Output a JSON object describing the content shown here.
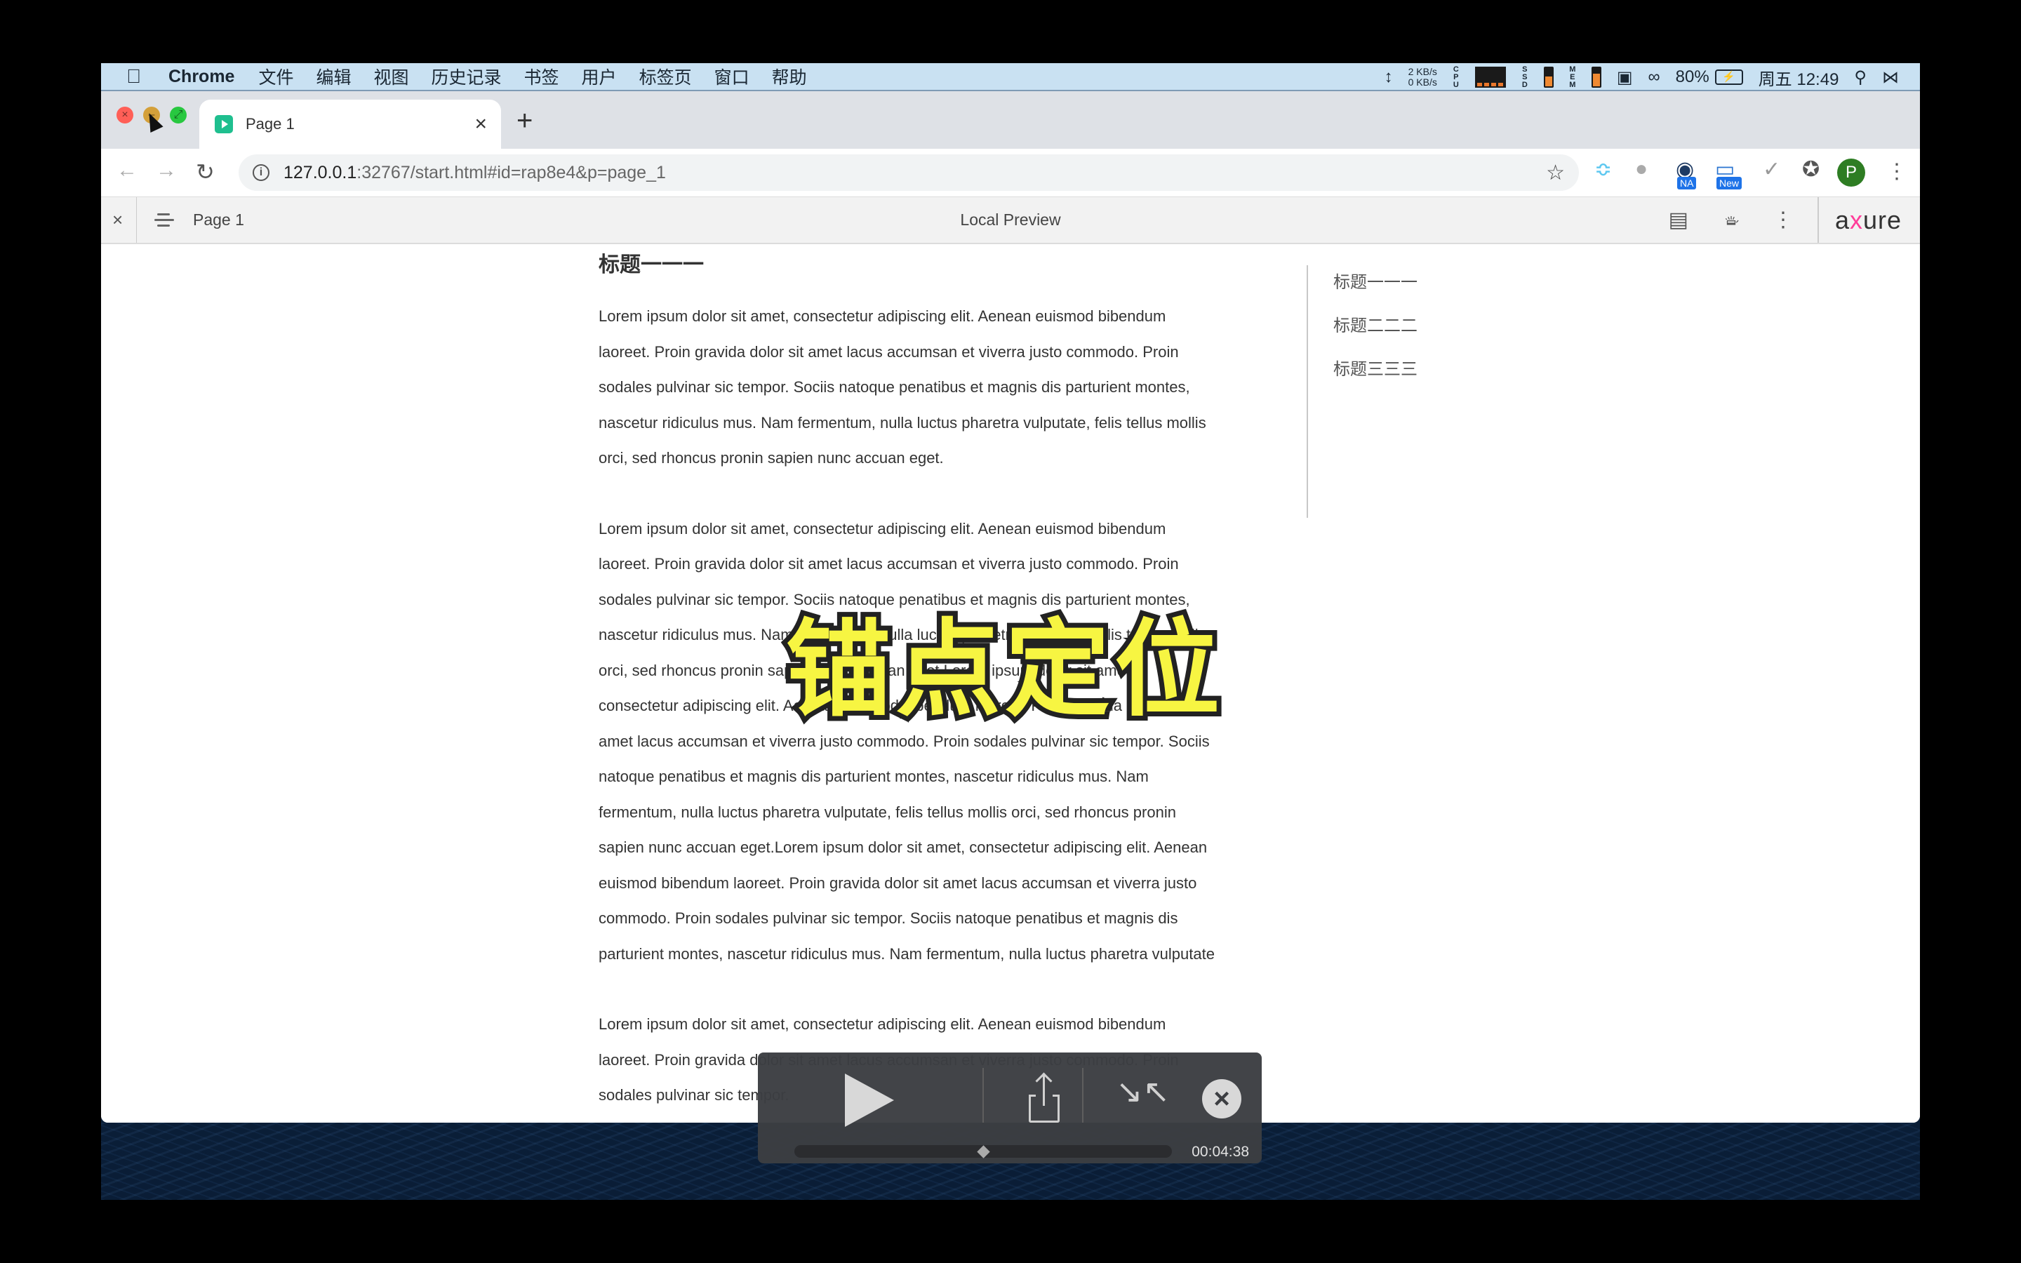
{
  "menubar": {
    "apple_icon": "apple-logo-icon",
    "app_name": "Chrome",
    "items": [
      "文件",
      "编辑",
      "视图",
      "历史记录",
      "书签",
      "用户",
      "标签页",
      "窗口",
      "帮助"
    ],
    "status": {
      "net_up": "2 KB/s",
      "net_down": "0 KB/s",
      "cpu_label": "CPU",
      "ssd_label": "SSD",
      "mem_label": "MEM",
      "ssd_fill": 0.55,
      "mem_fill": 0.7,
      "battery_percent": "80%",
      "datetime": "周五 12:49"
    }
  },
  "browser": {
    "tab": {
      "title": "Page 1",
      "close": "×"
    },
    "new_tab": "+",
    "url_host": "127.0.0.1",
    "url_rest": ":32767/start.html#id=rap8e4&p=page_1",
    "extensions": [
      {
        "name": "ext-waves-icon"
      },
      {
        "name": "ext-gray-swirl-icon"
      },
      {
        "name": "ext-na-icon",
        "badge": "NA"
      },
      {
        "name": "ext-new-icon",
        "badge": "New"
      },
      {
        "name": "ext-check-icon"
      },
      {
        "name": "extensions-puzzle-icon"
      }
    ],
    "profile_initial": "P"
  },
  "axure_bar": {
    "page_name": "Page 1",
    "center_label": "Local Preview",
    "logo": {
      "pre": "a",
      "x": "x",
      "post": "ure"
    }
  },
  "content": {
    "heading": "标题一一一",
    "paragraphs": [
      "Lorem ipsum dolor sit amet, consectetur adipiscing elit. Aenean euismod bibendum laoreet. Proin gravida dolor sit amet lacus accumsan et viverra justo commodo. Proin sodales pulvinar sic tempor. Sociis natoque penatibus et magnis dis parturient montes, nascetur ridiculus mus. Nam fermentum, nulla luctus pharetra vulputate, felis tellus mollis orci, sed rhoncus pronin sapien nunc accuan eget.",
      "Lorem ipsum dolor sit amet, consectetur adipiscing elit. Aenean euismod bibendum laoreet. Proin gravida dolor sit amet lacus accumsan et viverra justo commodo. Proin sodales pulvinar sic tempor. Sociis natoque penatibus et magnis dis parturient montes, nascetur ridiculus mus. Nam fermentum, nulla luctus pharetra vulputate, felis tellus mollis orci, sed rhoncus pronin sapien nunc accuan eget.Lorem ipsum dolor sit amet, consectetur adipiscing elit. Aenean euismod bibendum laoreet. Proin gravida dolor sit amet lacus accumsan et viverra justo commodo. Proin sodales pulvinar sic tempor. Sociis natoque penatibus et magnis dis parturient montes, nascetur ridiculus mus. Nam fermentum, nulla luctus pharetra vulputate, felis tellus mollis orci, sed rhoncus pronin sapien nunc accuan eget.Lorem ipsum dolor sit amet, consectetur adipiscing elit. Aenean euismod bibendum laoreet. Proin gravida dolor sit amet lacus accumsan et viverra justo commodo. Proin sodales pulvinar sic tempor. Sociis natoque penatibus et magnis dis parturient montes, nascetur ridiculus mus. Nam fermentum, nulla luctus pharetra vulputate",
      "Lorem ipsum dolor sit amet, consectetur adipiscing elit. Aenean euismod bibendum laoreet. Proin gravida dolor sit amet lacus accumsan et viverra justo commodo. Proin sodales pulvinar sic tempor."
    ],
    "toc": [
      "标题一一一",
      "标题二二二",
      "标题三三三"
    ]
  },
  "overlay": {
    "subtitle": "锚点定位",
    "subtitle_color": "#f7f542"
  },
  "player": {
    "time": "00:04:38",
    "progress": 0.5
  }
}
